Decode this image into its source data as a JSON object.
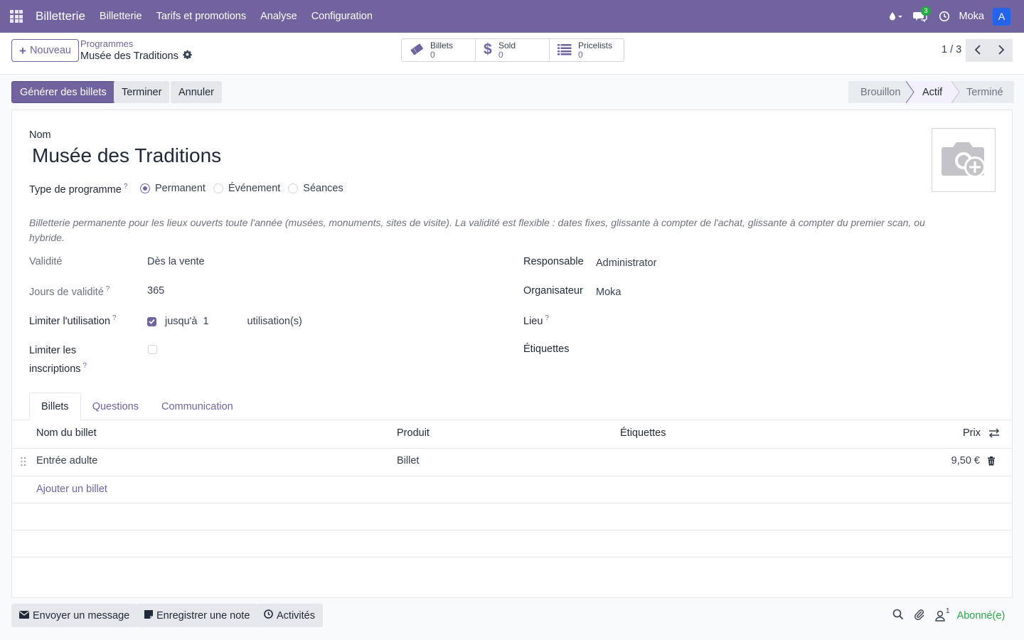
{
  "navbar": {
    "app_name": "Billetterie",
    "menu": [
      "Billetterie",
      "Tarifs et promotions",
      "Analyse",
      "Configuration"
    ],
    "messages_count": "3",
    "company": "Moka",
    "avatar_letter": "A"
  },
  "control": {
    "new_label": "Nouveau",
    "breadcrumb_parent": "Programmes",
    "breadcrumb_current": "Musée des Traditions",
    "stats": [
      {
        "label": "Billets",
        "value": "0",
        "icon": "ticket-icon"
      },
      {
        "label": "Sold",
        "value": "0",
        "icon": "dollar-icon"
      },
      {
        "label": "Pricelists",
        "value": "0",
        "icon": "list-icon"
      }
    ],
    "pager": "1 / 3"
  },
  "statusbar": {
    "generate_label": "Générer des billets",
    "finish_label": "Terminer",
    "cancel_label": "Annuler",
    "states": [
      "Brouillon",
      "Actif",
      "Terminé"
    ],
    "active_state": "Actif"
  },
  "form": {
    "name_label": "Nom",
    "name_value": "Musée des Traditions",
    "program_type_label": "Type de programme",
    "program_type_help": "?",
    "program_types": [
      "Permanent",
      "Événement",
      "Séances"
    ],
    "program_type_selected": "Permanent",
    "description": "Billetterie permanente pour les lieux ouverts toute l'année (musées, monuments, sites de visite). La validité est flexible : dates fixes, glissante à compter de l'achat, glissante à compter du premier scan, ou hybride.",
    "validity_label": "Validité",
    "validity_value": "Dès la vente",
    "validity_days_label": "Jours de validité",
    "validity_days_value": "365",
    "limit_usage_label": "Limiter l'utilisation",
    "limit_usage_checked": true,
    "limit_usage_prefix": "jusqu'à",
    "limit_usage_count": "1",
    "limit_usage_suffix": "utilisation(s)",
    "limit_reg_label_1": "Limiter les",
    "limit_reg_label_2": "inscriptions",
    "limit_reg_checked": false,
    "responsible_label": "Responsable",
    "responsible_value": "Administrator",
    "organizer_label": "Organisateur",
    "organizer_value": "Moka",
    "place_label": "Lieu",
    "tags_label": "Étiquettes"
  },
  "tabs": [
    "Billets",
    "Questions",
    "Communication"
  ],
  "active_tab": "Billets",
  "tickets_table": {
    "columns": [
      "Nom du billet",
      "Produit",
      "Étiquettes",
      "Prix"
    ],
    "rows": [
      {
        "name": "Entrée adulte",
        "product": "Billet",
        "tags": "",
        "price": "9,50 €"
      }
    ],
    "add_label": "Ajouter un billet"
  },
  "chatter": {
    "send_message": "Envoyer un message",
    "log_note": "Enregistrer une note",
    "activities": "Activités",
    "followers_count": "1",
    "follow_state": "Abonné(e)"
  },
  "colors": {
    "brand": "#71639e",
    "success": "#28a745",
    "avatar": "#2563eb"
  }
}
